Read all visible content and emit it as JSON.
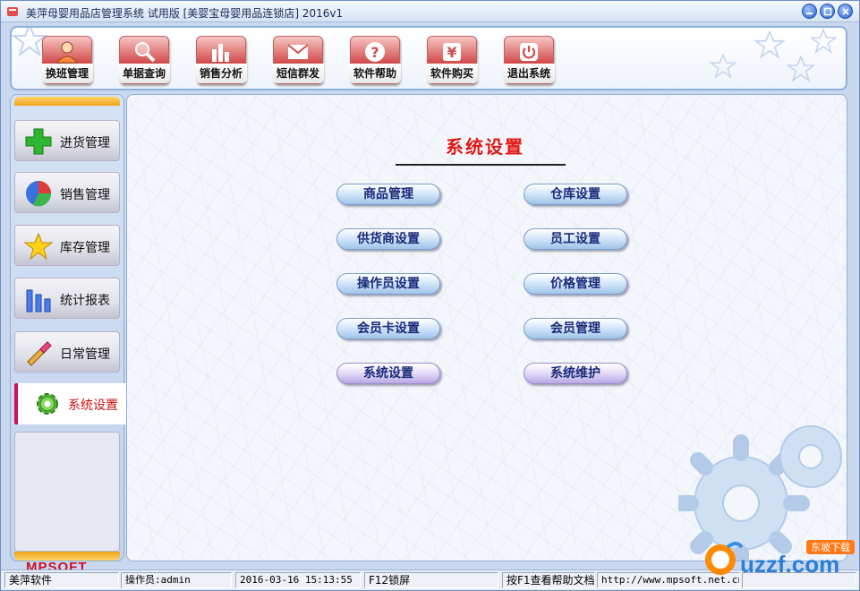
{
  "window": {
    "title": "美萍母婴用品店管理系统 试用版 [美婴宝母婴用品连锁店]  2016v1"
  },
  "toolbar": {
    "buttons": [
      {
        "label": "换班管理",
        "icon": "user-icon"
      },
      {
        "label": "单据查询",
        "icon": "magnifier-icon"
      },
      {
        "label": "销售分析",
        "icon": "bar-chart-icon"
      },
      {
        "label": "短信群发",
        "icon": "envelope-icon"
      },
      {
        "label": "软件帮助",
        "icon": "help-icon"
      },
      {
        "label": "软件购买",
        "icon": "yen-icon"
      },
      {
        "label": "退出系统",
        "icon": "power-icon"
      }
    ]
  },
  "sidebar": {
    "items": [
      {
        "label": "进货管理",
        "icon": "plus-icon"
      },
      {
        "label": "销售管理",
        "icon": "pie-icon"
      },
      {
        "label": "库存管理",
        "icon": "star-icon"
      },
      {
        "label": "统计报表",
        "icon": "bars-icon"
      },
      {
        "label": "日常管理",
        "icon": "brush-icon"
      }
    ],
    "active": {
      "label": "系统设置",
      "icon": "gear-icon"
    },
    "brand": "MPSOFT"
  },
  "main": {
    "title": "系统设置",
    "buttons": [
      {
        "label": "商品管理"
      },
      {
        "label": "仓库设置"
      },
      {
        "label": "供货商设置"
      },
      {
        "label": "员工设置"
      },
      {
        "label": "操作员设置"
      },
      {
        "label": "价格管理"
      },
      {
        "label": "会员卡设置"
      },
      {
        "label": "会员管理"
      },
      {
        "label": "系统设置"
      },
      {
        "label": "系统维护"
      }
    ]
  },
  "statusbar": {
    "company": "美萍软件",
    "operator": "操作员:admin",
    "datetime": "2016-03-16 15:13:55",
    "lock_hint": "F12锁屏",
    "help_hint": "按F1查看帮助文档",
    "website": "http://www.mpsoft.net.cn"
  },
  "watermark": {
    "text": "uzzf.com",
    "tag": "东坡下载"
  },
  "colors": {
    "accent_red": "#e01515",
    "frame_blue": "#8fb0da",
    "active_marker": "#d0105f"
  }
}
